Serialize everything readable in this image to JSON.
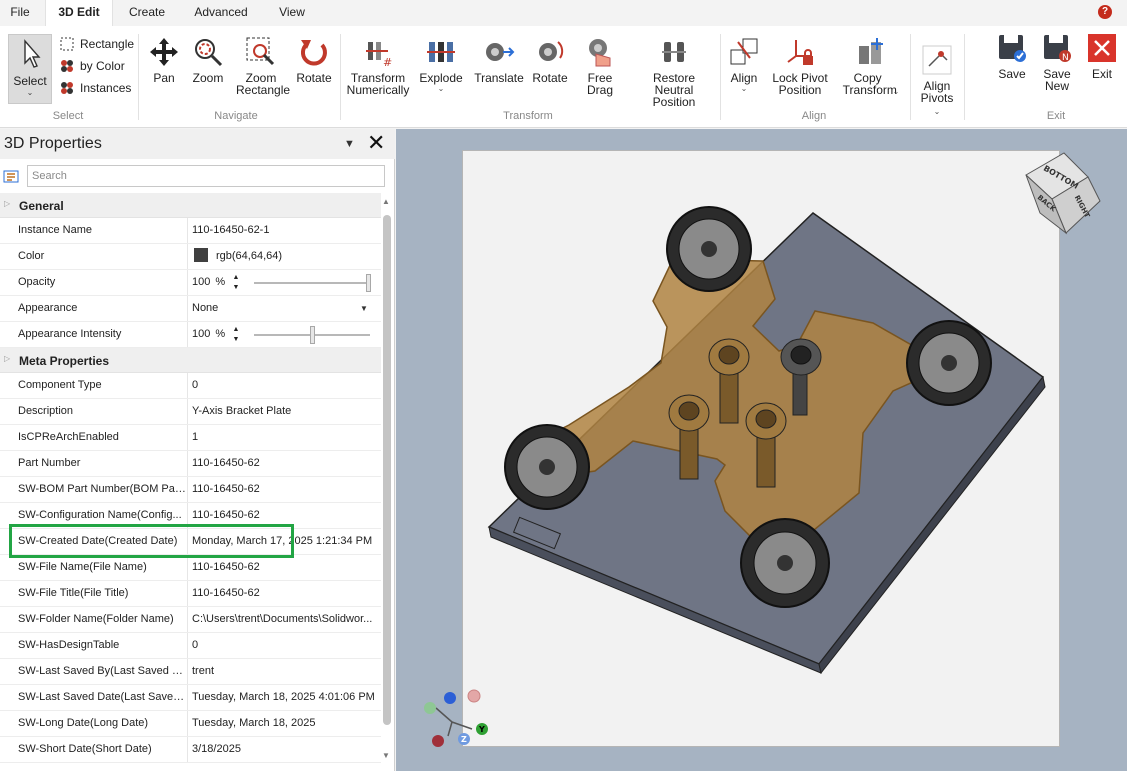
{
  "tabs": [
    "File",
    "3D Edit",
    "Create",
    "Advanced",
    "View"
  ],
  "active_tab": "3D Edit",
  "help_label": "?",
  "ribbon": {
    "select": {
      "label": "Select",
      "options": [
        "Rectangle",
        "by Color",
        "Instances"
      ],
      "group": "Select"
    },
    "navigate": {
      "buttons": [
        "Pan",
        "Zoom",
        "Zoom Rectangle",
        "Rotate"
      ],
      "group": "Navigate"
    },
    "transform": {
      "buttons": [
        "Transform Numerically",
        "Explode",
        "Translate",
        "Rotate",
        "Free Drag",
        "Restore Neutral Position"
      ],
      "group": "Transform"
    },
    "align": {
      "buttons": [
        "Align",
        "Lock Pivot Position",
        "Copy Transform"
      ],
      "group": "Align"
    },
    "align_pivots": {
      "label": "Align Pivots"
    },
    "exit": {
      "buttons": [
        "Save",
        "Save New",
        "Exit"
      ],
      "group": "Exit"
    }
  },
  "panel": {
    "title": "3D Properties",
    "search_placeholder": "Search",
    "general": {
      "label": "General",
      "instance_name_label": "Instance Name",
      "instance_name": "110-16450-62-1",
      "color_label": "Color",
      "color_value": "rgb(64,64,64)",
      "color_hex": "#404040",
      "opacity_label": "Opacity",
      "opacity": "100",
      "opacity_fraction": 1.0,
      "appearance_label": "Appearance",
      "appearance": "None",
      "intensity_label": "Appearance Intensity",
      "intensity": "100",
      "intensity_fraction": 0.5,
      "percent_sign": "%"
    },
    "meta": {
      "label": "Meta Properties",
      "rows": [
        {
          "name": "Component Type",
          "value": "0"
        },
        {
          "name": "Description",
          "value": "Y-Axis Bracket Plate"
        },
        {
          "name": "IsCPReArchEnabled",
          "value": "1"
        },
        {
          "name": "Part Number",
          "value": "110-16450-62"
        },
        {
          "name": "SW-BOM Part Number(BOM Part...",
          "value": "110-16450-62"
        },
        {
          "name": "SW-Configuration Name(Config...",
          "value": "110-16450-62"
        },
        {
          "name": "SW-Created Date(Created Date)",
          "value": "Monday, March 17, 2025 1:21:34 PM"
        },
        {
          "name": "SW-File Name(File Name)",
          "value": "110-16450-62"
        },
        {
          "name": "SW-File Title(File Title)",
          "value": "110-16450-62"
        },
        {
          "name": "SW-Folder Name(Folder Name)",
          "value": "C:\\Users\\trent\\Documents\\Solidwor..."
        },
        {
          "name": "SW-HasDesignTable",
          "value": "0"
        },
        {
          "name": "SW-Last Saved By(Last Saved By)",
          "value": "trent"
        },
        {
          "name": "SW-Last Saved Date(Last Saved ...",
          "value": "Tuesday, March 18, 2025 4:01:06 PM"
        },
        {
          "name": "SW-Long Date(Long Date)",
          "value": "Tuesday, March 18, 2025"
        },
        {
          "name": "SW-Short Date(Short Date)",
          "value": "3/18/2025"
        }
      ]
    }
  },
  "viewcube": {
    "faces": [
      "BOTTOM",
      "RIGHT",
      "BACK"
    ]
  },
  "triad": {
    "label": "Y",
    "label_z": "Z"
  }
}
